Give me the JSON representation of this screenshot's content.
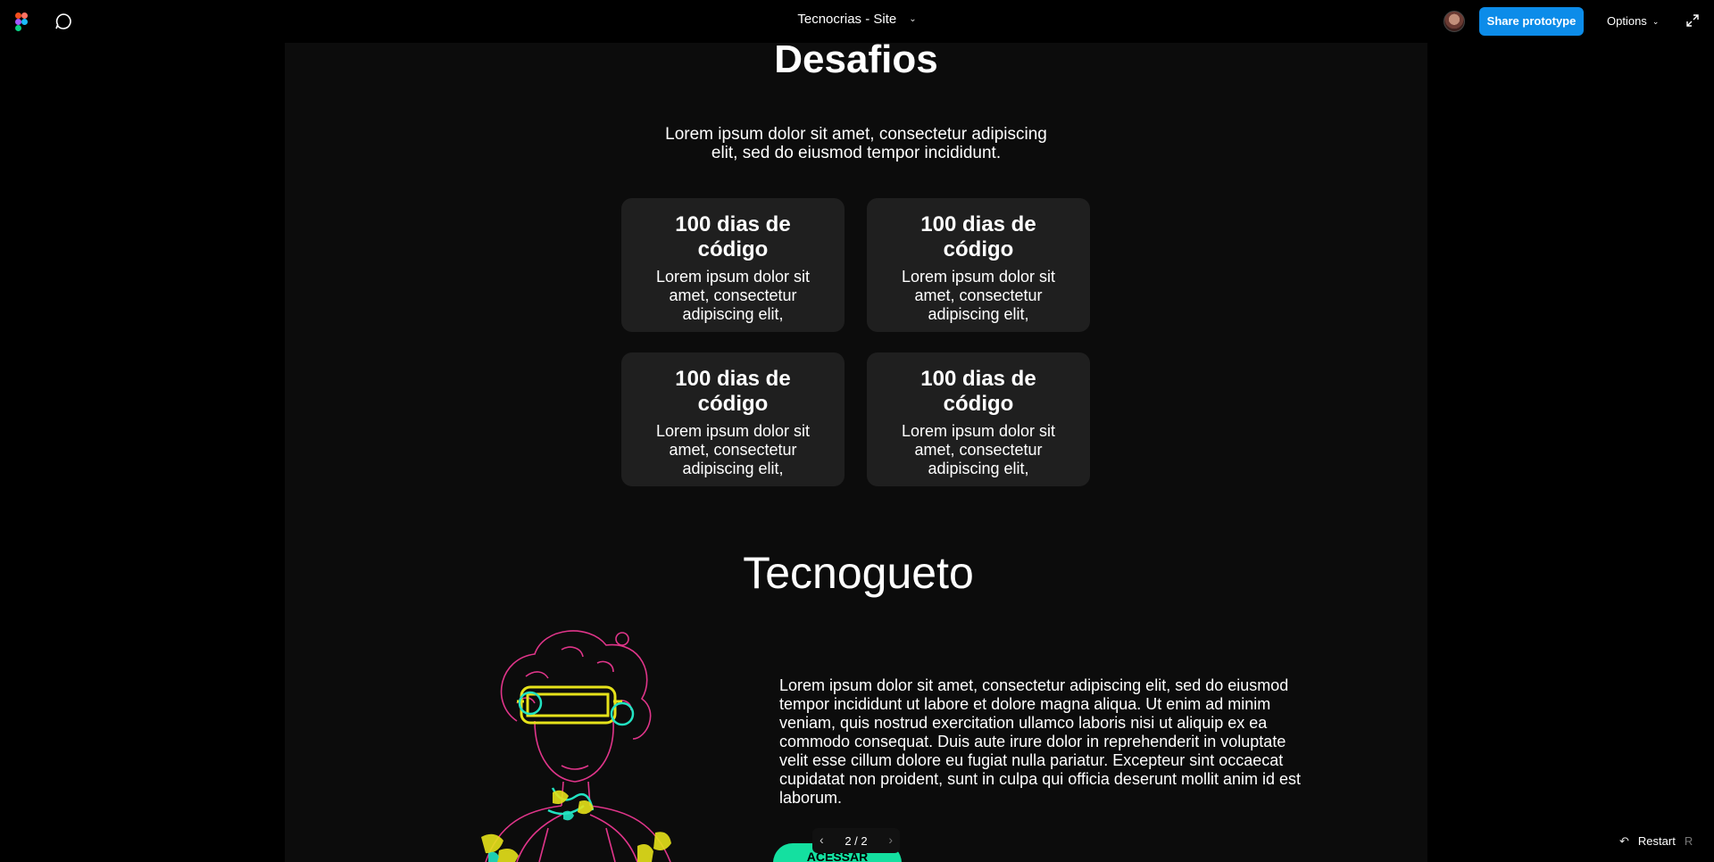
{
  "topbar": {
    "file_title": "Tecnocrias - Site",
    "share_label": "Share prototype",
    "options_label": "Options"
  },
  "frame": {
    "section_title": "Desafios",
    "section_description": "Lorem ipsum dolor sit amet, consectetur adipiscing elit, sed do eiusmod tempor incididunt.",
    "cards": [
      {
        "title": "100 dias de código",
        "body": "Lorem ipsum dolor sit amet, consectetur adipiscing elit,"
      },
      {
        "title": "100 dias de código",
        "body": "Lorem ipsum dolor sit amet, consectetur adipiscing elit,"
      },
      {
        "title": "100 dias de código",
        "body": "Lorem ipsum dolor sit amet, consectetur adipiscing elit,"
      },
      {
        "title": "100 dias de código",
        "body": "Lorem ipsum dolor sit amet, consectetur adipiscing elit,"
      }
    ],
    "tecnogueto_title": "Tecnogueto",
    "tecnogueto_body": "Lorem ipsum dolor sit amet, consectetur adipiscing elit, sed do eiusmod tempor incididunt ut labore et dolore magna aliqua. Ut enim ad minim veniam, quis nostrud exercitation ullamco laboris nisi ut aliquip ex ea commodo consequat. Duis aute irure dolor in reprehenderit in voluptate velit esse cillum dolore eu fugiat nulla pariatur. Excepteur sint occaecat cupidatat non proident, sunt in culpa qui officia deserunt mollit anim id est laborum.",
    "access_label": "ACESSAR"
  },
  "pager": {
    "count": "2 / 2"
  },
  "restart": {
    "label": "Restart",
    "shortcut": "R"
  },
  "colors": {
    "accent_blue": "#0c8ce9",
    "accent_green": "#14e0a0",
    "card_bg": "#1f1f1f",
    "frame_bg": "#0c0c0c"
  },
  "icons": {
    "logo": "figma-logo-icon",
    "comment": "comment-bubble-icon",
    "expand": "expand-icon",
    "restart": "restart-arrow-icon"
  }
}
